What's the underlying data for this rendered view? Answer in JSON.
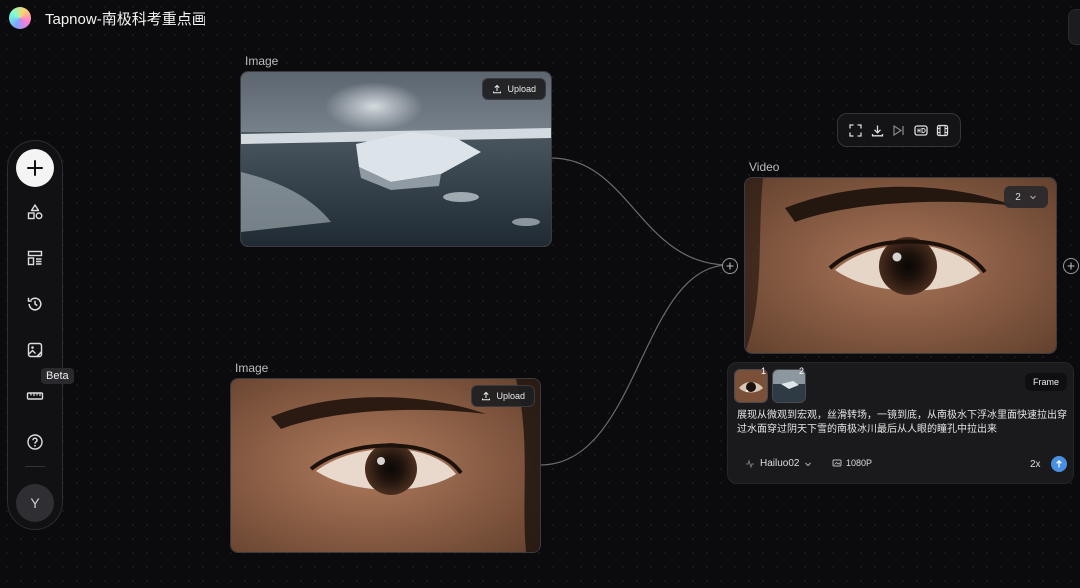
{
  "app": {
    "title": "Tapnow-南极科考重点画面"
  },
  "toolbar": {
    "beta_label": "Beta",
    "avatar_initial": "Y"
  },
  "nodes": {
    "image1": {
      "label": "Image",
      "upload_label": "Upload"
    },
    "image2": {
      "label": "Image",
      "upload_label": "Upload"
    },
    "video": {
      "label": "Video",
      "count": "2"
    }
  },
  "prompt_panel": {
    "thumb1_num": "1",
    "thumb2_num": "2",
    "frame_label": "Frame",
    "prompt_text": "展现从微观到宏观，丝滑转场，一镜到底，从南极水下浮冰里面快速拉出穿过水面穿过阴天下雪的南极冰川最后从人眼的瞳孔中拉出来",
    "model": "Hailuo02",
    "resolution": "1080P",
    "multiplier": "2x"
  }
}
